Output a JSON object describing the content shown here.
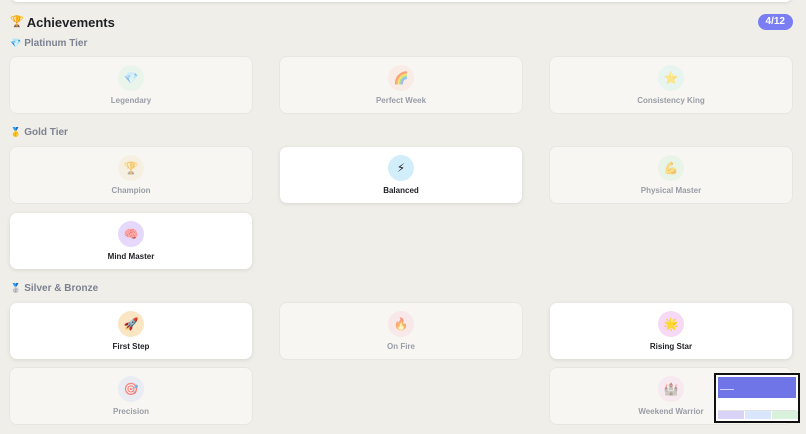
{
  "header": {
    "title": "Achievements",
    "title_icon": "trophy-icon",
    "count": "4/12"
  },
  "tiers": [
    {
      "label": "Platinum Tier",
      "icon": "gem-icon"
    },
    {
      "label": "Gold Tier",
      "icon": "medal-icon"
    },
    {
      "label": "Silver & Bronze",
      "icon": "medal-icon"
    }
  ],
  "cards": [
    {
      "label": "Legendary",
      "icon": "gem-icon",
      "glyph": "💎",
      "unlocked": false,
      "color": "#dff3e4"
    },
    {
      "label": "Perfect Week",
      "icon": "rainbow-icon",
      "glyph": "🌈",
      "unlocked": false,
      "color": "#fbe3dc"
    },
    {
      "label": "Consistency King",
      "icon": "star-icon",
      "glyph": "⭐",
      "unlocked": false,
      "color": "#dcf3ef"
    },
    {
      "label": "Champion",
      "icon": "trophy-icon",
      "glyph": "🏆",
      "unlocked": false,
      "color": "#f4ecd6"
    },
    {
      "label": "Balanced",
      "icon": "lightning-icon",
      "glyph": "⚡",
      "unlocked": true,
      "color": "#d3eefb"
    },
    {
      "label": "Physical Master",
      "icon": "flexed-arm-icon",
      "glyph": "💪",
      "unlocked": false,
      "color": "#dff3e0"
    },
    {
      "label": "Mind Master",
      "icon": "brain-icon",
      "glyph": "🧠",
      "unlocked": true,
      "color": "#e6d8fb"
    },
    {
      "label": "First Step",
      "icon": "rocket-icon",
      "glyph": "🚀",
      "unlocked": true,
      "color": "#fbe6c4"
    },
    {
      "label": "On Fire",
      "icon": "fire-icon",
      "glyph": "🔥",
      "unlocked": false,
      "color": "#fadde3"
    },
    {
      "label": "Rising Star",
      "icon": "glowing-star-icon",
      "glyph": "🌟",
      "unlocked": true,
      "color": "#f6d9f5"
    },
    {
      "label": "Precision",
      "icon": "target-icon",
      "glyph": "🎯",
      "unlocked": false,
      "color": "#dfe5f3"
    },
    {
      "label": "Weekend Warrior",
      "icon": "castle-icon",
      "glyph": "🏰",
      "unlocked": false,
      "color": "#f6e0ee"
    }
  ]
}
